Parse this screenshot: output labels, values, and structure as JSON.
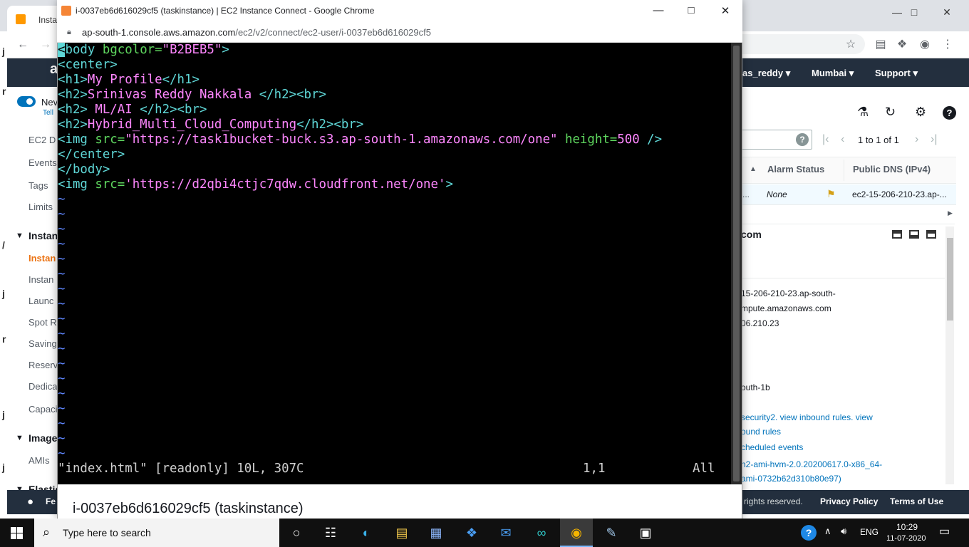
{
  "background_window": {
    "tab_title": "Insta",
    "aws_nav": {
      "user": "as_reddy",
      "region": "Mumbai",
      "support": "Support"
    },
    "sidebar": {
      "toggle_label": "Nev",
      "toggle_sub": "Tell",
      "items": [
        "EC2 D",
        "Events",
        "Tags",
        "Limits"
      ],
      "section_instances": "Instan",
      "instances_items": [
        "Instan",
        "Instan",
        "Launc",
        "Spot R",
        "Saving",
        "Reserv",
        "Dedica",
        "Capaci"
      ],
      "section_images": "Image",
      "images_items": [
        "AMIs"
      ],
      "section_elastic": "Elastic"
    },
    "pagination": "1 to 1 of 1",
    "table": {
      "headers": [
        "Alarm Status",
        "Public DNS (IPv4)"
      ],
      "row": {
        "alarm": "None",
        "dns": "ec2-15-206-210-23.ap-..."
      }
    },
    "details": {
      "heading": "com",
      "dns_line1": "15-206-210-23.ap-south-",
      "dns_line2": "mpute.amazonaws.com",
      "ip": "06.210.23",
      "az": "outh-1b",
      "sg_line1": "security2. view inbound rules. view",
      "sg_line2": "ound rules",
      "events": "cheduled events",
      "ami_line1": "n2-ami-hvm-2.0.20200617.0-x86_64-",
      "ami_line2": "ami-0732b62d310b80e97)"
    },
    "footer": {
      "rights": "rights reserved.",
      "privacy": "Privacy Policy",
      "terms": "Terms of Use",
      "feedback": "Fe"
    }
  },
  "popup": {
    "title": "i-0037eb6d616029cf5 (taskinstance) | EC2 Instance Connect - Google Chrome",
    "url_host": "ap-south-1.console.aws.amazon.com",
    "url_path": "/ec2/v2/connect/ec2-user/i-0037eb6d616029cf5",
    "footer_title": "i-0037eb6d616029cf5 (taskinstance)",
    "terminal": {
      "l1_tag_open": "<",
      "l1_tag": "body",
      "l1_attr": " bgcolor=",
      "l1_val": "\"B2BEB5\"",
      "l1_close": ">",
      "l2": "<center>",
      "l3_open": "<h1>",
      "l3_text": "My Profile",
      "l3_close": "</h1>",
      "l4_open": "<h2>",
      "l4_text": "Srinivas Reddy Nakkala ",
      "l4_close": "</h2><br>",
      "l5_open": "<h2>",
      "l5_text": " ML/AI ",
      "l5_close": "</h2><br>",
      "l6_open": "<h2>",
      "l6_text": "Hybrid_Multi_Cloud_Computing",
      "l6_close": "</h2><br>",
      "l7_open": "<img",
      "l7_attr": " src=",
      "l7_val": "\"https://task1bucket-buck.s3.ap-south-1.amazonaws.com/one\"",
      "l7_attr2": " height=",
      "l7_val2": "500",
      "l7_close": " />",
      "l8": "</center>",
      "l9": "</body>",
      "l10_open": "<img",
      "l10_attr": " src=",
      "l10_val": "'https://d2qbi4ctjc7qdw.cloudfront.net/one'",
      "l10_close": ">",
      "tilde": "~",
      "status_file": "\"index.html\" [readonly] 10L, 307C",
      "status_pos": "1,1",
      "status_all": "All"
    }
  },
  "taskbar": {
    "search_placeholder": "Type here to search",
    "lang": "ENG",
    "time": "10:29",
    "date": "11-07-2020"
  }
}
